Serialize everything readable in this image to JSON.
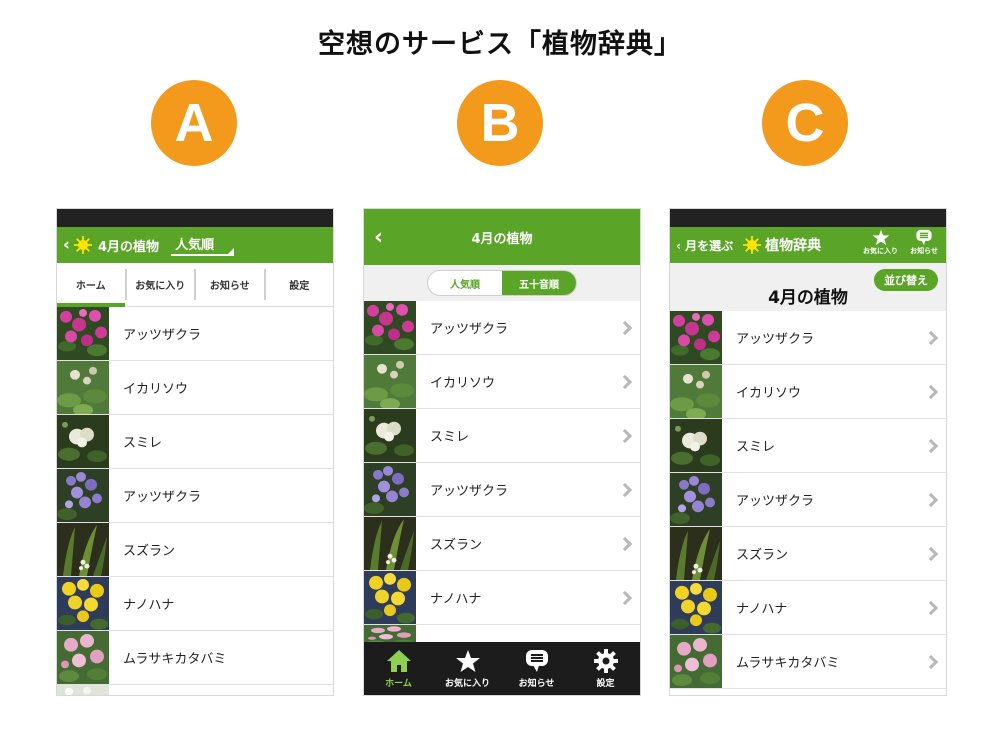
{
  "page_title": "空想のサービス「植物辞典」",
  "badges": [
    "A",
    "B",
    "C"
  ],
  "colors": {
    "accent": "#5aa528",
    "badge": "#f39a1c"
  },
  "plants": [
    {
      "name": "アッツザクラ",
      "thumb": "pink"
    },
    {
      "name": "イカリソウ",
      "thumb": "white-green"
    },
    {
      "name": "スミレ",
      "thumb": "white-dark"
    },
    {
      "name": "アッツザクラ",
      "thumb": "purple"
    },
    {
      "name": "スズラン",
      "thumb": "dark-leaf"
    },
    {
      "name": "ナノハナ",
      "thumb": "yellow"
    },
    {
      "name": "ムラサキカタバミ",
      "thumb": "pink-light"
    }
  ],
  "phoneA": {
    "back": "‹",
    "title": "4月の植物",
    "sort_label": "人気順",
    "tabs": [
      "ホーム",
      "お気に入り",
      "お知らせ",
      "設定"
    ]
  },
  "phoneB": {
    "back": "‹",
    "title": "4月の植物",
    "segments": [
      "人気順",
      "五十音順"
    ],
    "tabbar": [
      "ホーム",
      "お気に入り",
      "お知らせ",
      "設定"
    ]
  },
  "phoneC": {
    "back": "‹ 月を選ぶ",
    "app_title": "植物辞典",
    "fav_label": "お気に入り",
    "news_label": "お知らせ",
    "heading": "4月の植物",
    "sort_button": "並び替え"
  }
}
